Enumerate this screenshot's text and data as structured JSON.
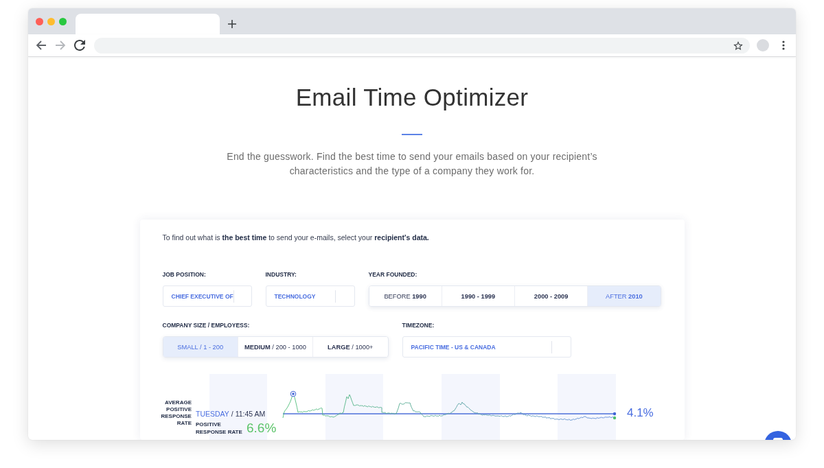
{
  "browser": {
    "tabs": [
      {
        "selected": true
      }
    ],
    "back": {
      "disabled": false
    },
    "forward": {
      "disabled": true
    }
  },
  "header": {
    "title": "Email Time Optimizer",
    "subtitle": "End the guesswork. Find the best time to send your emails based on your recipient’s characteristics and the type of a company they work for."
  },
  "form": {
    "intro": "To find out what is **the best time** to send your e-mails, select your **recipient's data.**",
    "filters": [
      {
        "kind": "select",
        "label": "JOB POSITION:",
        "value": "CHIEF EXECUTIVE OF"
      },
      {
        "kind": "select",
        "label": "INDUSTRY:",
        "value": "TECHNOLOGY"
      },
      {
        "kind": "segmented",
        "label": "YEAR FOUNDED:",
        "options": [
          {
            "text": "BEFORE **1990**",
            "selected": false
          },
          {
            "text": "**1990 - 1999**",
            "selected": false
          },
          {
            "text": "**2000 - 2009**",
            "selected": false
          },
          {
            "text": "AFTER **2010**",
            "selected": true
          }
        ]
      },
      {
        "kind": "segmented",
        "label": "COMPANY SIZE / EMPLOYESS:",
        "options": [
          {
            "text": "SMALL / 1 - 200",
            "selected": true
          },
          {
            "text": "**MEDIUM** / 200 - 1000",
            "selected": false
          },
          {
            "text": "**LARGE** / 1000+",
            "selected": false
          }
        ]
      },
      {
        "kind": "select",
        "label": "TIMEZONE:",
        "value": "PACIFIC TIME - US & CANADA"
      }
    ]
  },
  "response_chart": {
    "average_label": "AVERAGE POSITIVE RESPONSE RATE",
    "day": "TUESDAY",
    "time": "/ 11:45 AM",
    "rate_label": "POSITIVE RESPONSE RATE",
    "rate": "6.6%",
    "average": "4.1%"
  }
}
